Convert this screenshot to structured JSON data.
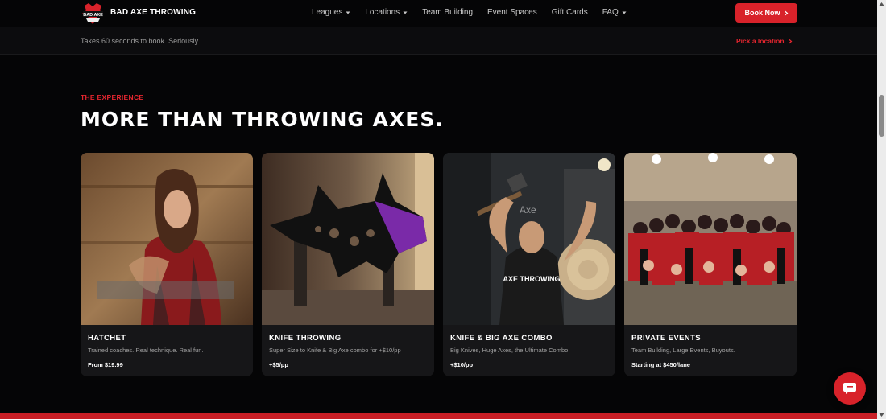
{
  "header": {
    "brand": "BAD AXE THROWING",
    "logo_text": "BAD AXE",
    "nav": [
      {
        "label": "Leagues",
        "dropdown": true
      },
      {
        "label": "Locations",
        "dropdown": true
      },
      {
        "label": "Team Building",
        "dropdown": false
      },
      {
        "label": "Event Spaces",
        "dropdown": false
      },
      {
        "label": "Gift Cards",
        "dropdown": false
      },
      {
        "label": "FAQ",
        "dropdown": true
      }
    ],
    "book_now": "Book Now"
  },
  "subbar": {
    "text": "Takes 60 seconds to book. Seriously.",
    "pick_location": "Pick a location"
  },
  "section": {
    "eyebrow": "THE EXPERIENCE",
    "headline": "MORE THAN THROWING AXES."
  },
  "cards": [
    {
      "title": "HATCHET",
      "desc": "Trained coaches. Real technique. Real fun.",
      "price": "From $19.99"
    },
    {
      "title": "KNIFE THROWING",
      "desc": "Super Size to Knife & Big Axe combo for +$10/pp",
      "price": "+$5/pp"
    },
    {
      "title": "KNIFE & BIG AXE COMBO",
      "desc": "Big Knives, Huge Axes, the Ultimate Combo",
      "price": "+$10/pp"
    },
    {
      "title": "PRIVATE EVENTS",
      "desc": "Team Building, Large Events, Buyouts.",
      "price": "Starting at $450/lane"
    }
  ],
  "card_image_text": {
    "shirt": "AXE THROWING",
    "wall": "Axe"
  },
  "colors": {
    "accent": "#d8222a",
    "background": "#050506",
    "card": "#161618"
  },
  "icons": {
    "chat": "chat-bubble-icon",
    "chevron": "chevron-right-icon"
  }
}
